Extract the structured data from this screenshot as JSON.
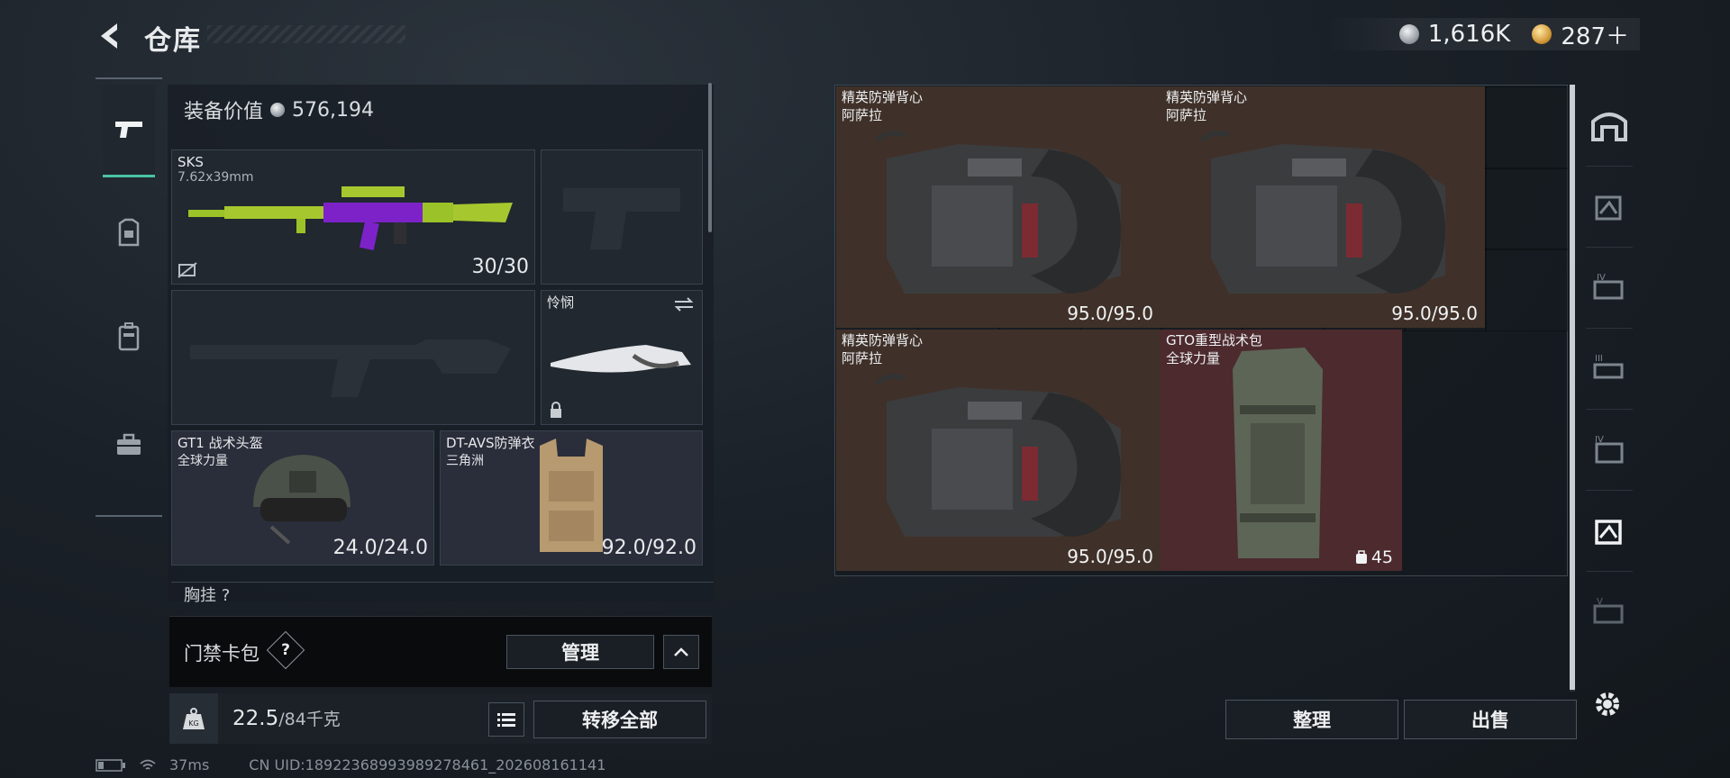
{
  "header": {
    "title": "仓库",
    "currency1": "1,616K",
    "currency2": "287＋"
  },
  "loadout": {
    "value_label": "装备价值",
    "value": "576,194",
    "primary": {
      "name": "SKS",
      "caliber": "7.62x39mm",
      "ammo": "30/30"
    },
    "melee": {
      "name": "怜悯"
    },
    "helmet": {
      "name": "GT1 战术头盔",
      "faction": "全球力量",
      "durability": "24.0/24.0"
    },
    "armor": {
      "name": "DT-AVS防弹衣",
      "faction": "三角洲",
      "durability": "92.0/92.0"
    },
    "chest_label": "胸挂 ?"
  },
  "keycase": {
    "label": "门禁卡包",
    "help": "?",
    "manage_label": "管理"
  },
  "bottom": {
    "weight": "22.5",
    "weight_max": "/84千克",
    "transfer_label": "转移全部"
  },
  "status": {
    "ping": "37ms",
    "uid": "CN UID:18922368993989278461_202608161141"
  },
  "storage": {
    "items": [
      {
        "name": "精英防弹背心",
        "faction": "阿萨拉",
        "durability": "95.0/95.0"
      },
      {
        "name": "精英防弹背心",
        "faction": "阿萨拉",
        "durability": "95.0/95.0"
      },
      {
        "name": "精英防弹背心",
        "faction": "阿萨拉",
        "durability": "95.0/95.0"
      },
      {
        "name": "GTO重型战术包",
        "faction": "全球力量",
        "capacity": "45"
      }
    ],
    "sort_label": "整理",
    "sell_label": "出售"
  },
  "colors": {
    "accent": "#49c3a5",
    "vest_bg": "#3f3129",
    "bag_bg": "#4c2a2e"
  }
}
